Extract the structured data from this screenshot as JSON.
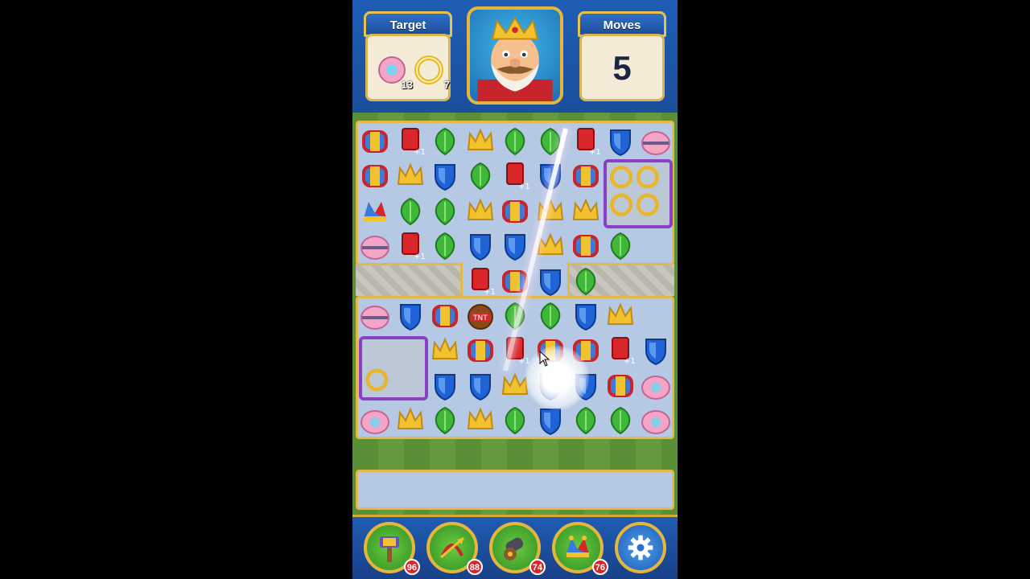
{
  "header": {
    "target_label": "Target",
    "moves_label": "Moves",
    "moves_value": "5"
  },
  "targets": [
    {
      "item": "pink-pearl-shell",
      "count": "13"
    },
    {
      "item": "gold-ring",
      "count": "7"
    }
  ],
  "boosters": [
    {
      "name": "hammer",
      "count": "96"
    },
    {
      "name": "arrow",
      "count": "88"
    },
    {
      "name": "cannon",
      "count": "74"
    },
    {
      "name": "jester-hat",
      "count": "76"
    }
  ],
  "colors": {
    "accent_gold": "#e2b84a",
    "bar_blue": "#1f5db4",
    "badge_red": "#d8262a",
    "box_purple": "#8a3fc4"
  }
}
